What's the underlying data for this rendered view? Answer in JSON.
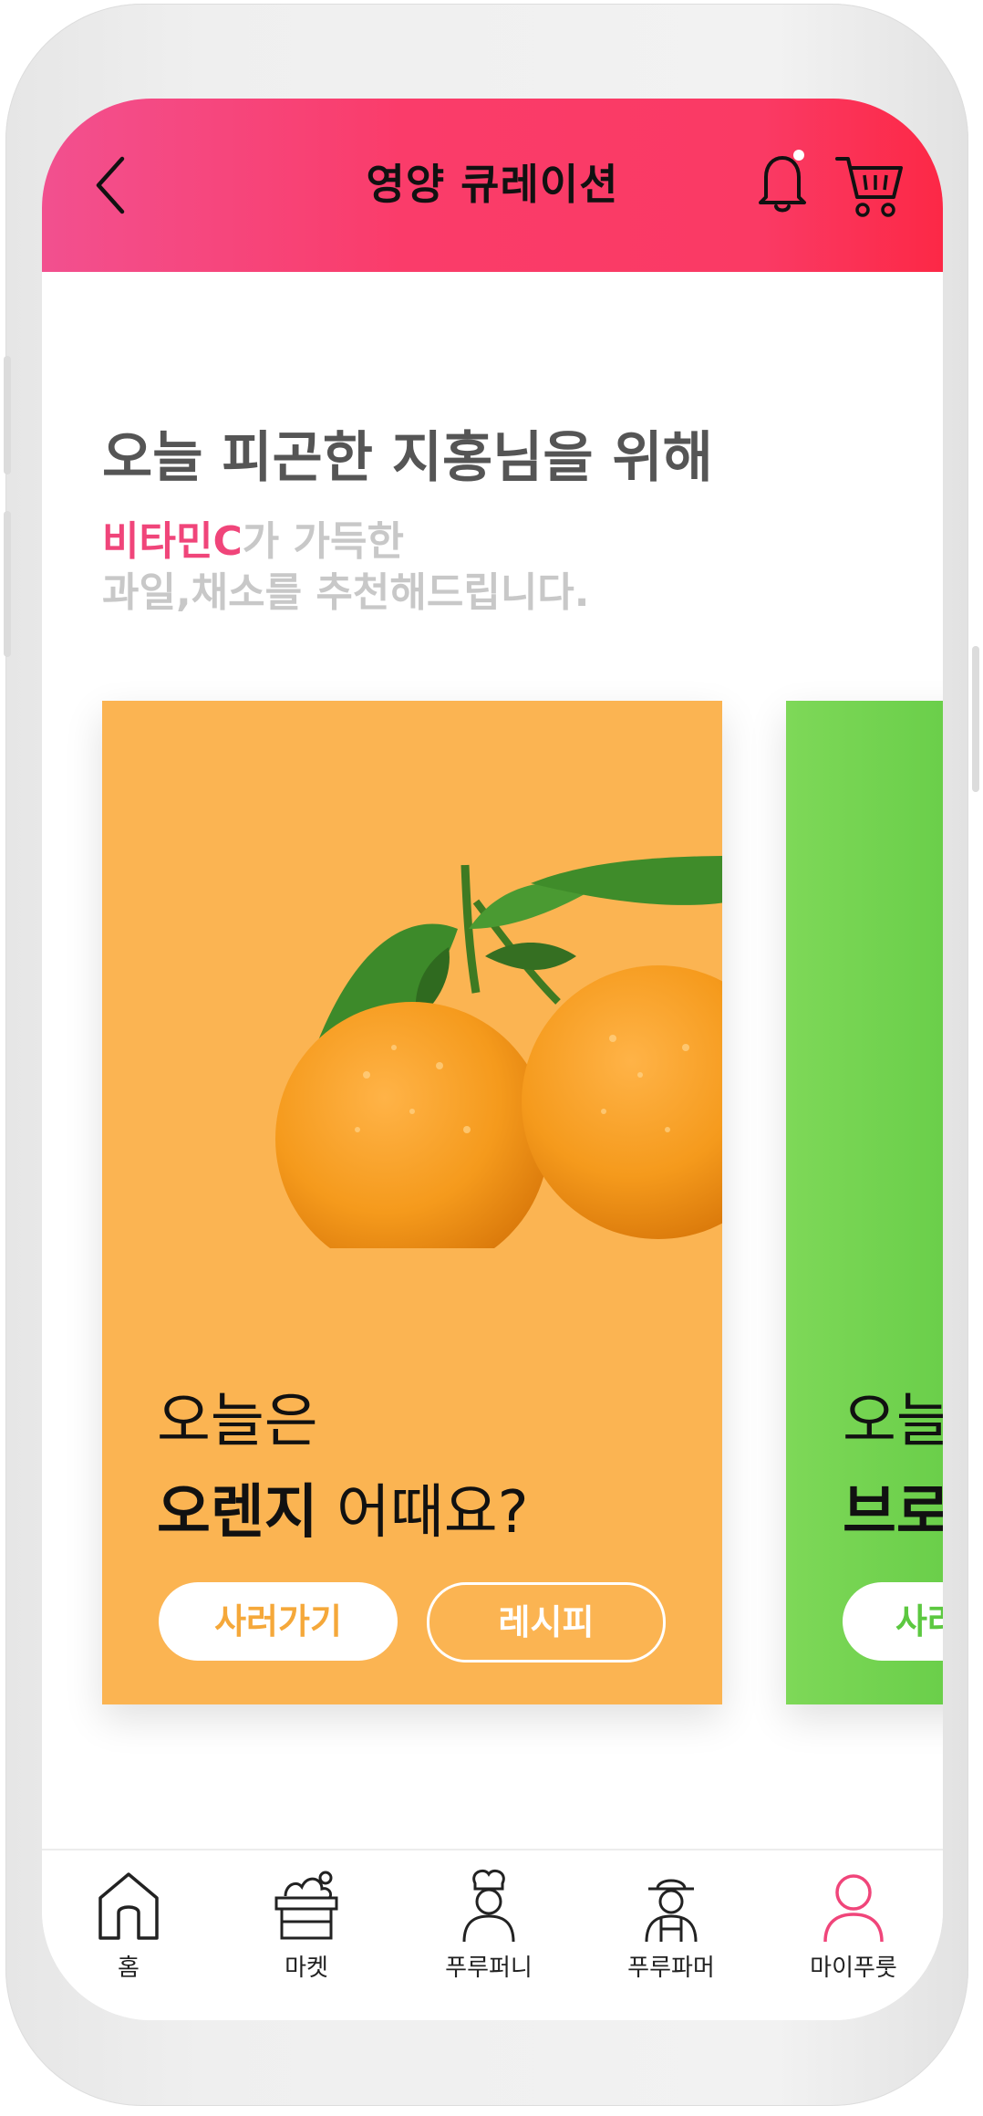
{
  "header": {
    "title": "영양 큐레이션"
  },
  "greeting": "오늘 피곤한 지홍님을 위해",
  "subtitle": {
    "highlight": "비타민C",
    "line1_rest": "가 가득한",
    "line2": "과일,채소를 추천해드립니다."
  },
  "cards": [
    {
      "line1": "오늘은",
      "product": "오렌지",
      "suffix": " 어때요?",
      "buy_label": "사러가기",
      "recipe_label": "레시피",
      "color": "#fbb452"
    },
    {
      "line1": "오늘",
      "product": "브로",
      "buy_label": "사러",
      "color": "#6fd24c"
    }
  ],
  "nav": {
    "items": [
      {
        "label": "홈",
        "icon": "home-icon"
      },
      {
        "label": "마켓",
        "icon": "market-basket-icon"
      },
      {
        "label": "푸루퍼니",
        "icon": "chef-icon"
      },
      {
        "label": "푸루파머",
        "icon": "farmer-icon"
      },
      {
        "label": "마이푸룻",
        "icon": "user-icon",
        "active": true
      }
    ]
  },
  "colors": {
    "accent": "#fa3c6a",
    "highlight": "#f0457a",
    "card_orange": "#fbb452",
    "card_green": "#6fd24c"
  }
}
